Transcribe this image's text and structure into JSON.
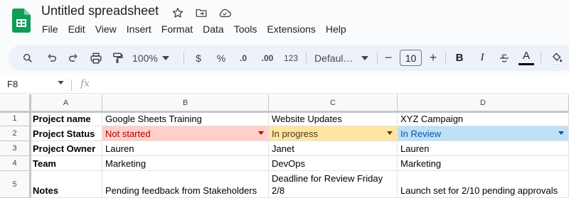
{
  "app": {
    "doc_title": "Untitled spreadsheet",
    "title_icons": [
      "star-icon",
      "move-to-folder-icon",
      "cloud-saved-icon"
    ],
    "menu": [
      "File",
      "Edit",
      "View",
      "Insert",
      "Format",
      "Data",
      "Tools",
      "Extensions",
      "Help"
    ]
  },
  "toolbar": {
    "zoom": "100%",
    "currency": "$",
    "percent": "%",
    "decrease_decimal": ".0",
    "increase_decimal": ".00",
    "number_format": "123",
    "font": "Defaul…",
    "font_size": "10",
    "minus": "−",
    "plus": "+",
    "bold": "B",
    "italic": "I",
    "text_color": "A"
  },
  "formula_bar": {
    "name_box": "F8",
    "fx": "fx"
  },
  "grid": {
    "columns": [
      "A",
      "B",
      "C",
      "D"
    ],
    "rows": [
      {
        "num": "1",
        "cells": [
          "Project name",
          "Google Sheets Training",
          "Website Updates",
          "XYZ Campaign"
        ]
      },
      {
        "num": "2",
        "cells": [
          "Project Status",
          "Not started",
          "In progress",
          "In Review"
        ]
      },
      {
        "num": "3",
        "cells": [
          "Project Owner",
          "Lauren",
          "Janet",
          "Lauren"
        ]
      },
      {
        "num": "4",
        "cells": [
          "Team",
          "Marketing",
          "DevOps",
          "Marketing"
        ]
      },
      {
        "num": "5",
        "cells": [
          "Notes",
          "Pending feedback from Stakeholders",
          "Deadline for Review Friday 2/8",
          "Launch set for 2/10 pending approvals"
        ]
      }
    ],
    "status_colors": {
      "not_started_bg": "#ffcfc9",
      "not_started_text": "#b10202",
      "in_progress_bg": "#ffe5a0",
      "in_progress_text": "#473821",
      "in_review_bg": "#bfe1f6",
      "in_review_text": "#0a53a8"
    }
  },
  "colors": {
    "brand_green": "#0f9d58",
    "chrome_bg": "#f9fbfd",
    "toolbar_bg": "#edf2fa"
  }
}
